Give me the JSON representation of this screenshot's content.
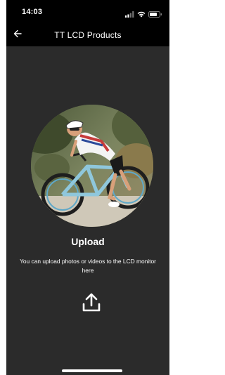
{
  "status_bar": {
    "time": "14:03",
    "icons": [
      "signal-icon",
      "wifi-icon",
      "battery-icon"
    ]
  },
  "nav": {
    "back_icon": "back-arrow-icon",
    "title": "TT LCD Products"
  },
  "content": {
    "photo_subject": "cyclist-photo",
    "upload_title": "Upload",
    "upload_description": "You can upload photos or videos to the LCD monitor here",
    "upload_icon": "upload-icon"
  },
  "colors": {
    "background": "#2b2b2b",
    "bar": "#000000",
    "text": "#ffffff"
  }
}
